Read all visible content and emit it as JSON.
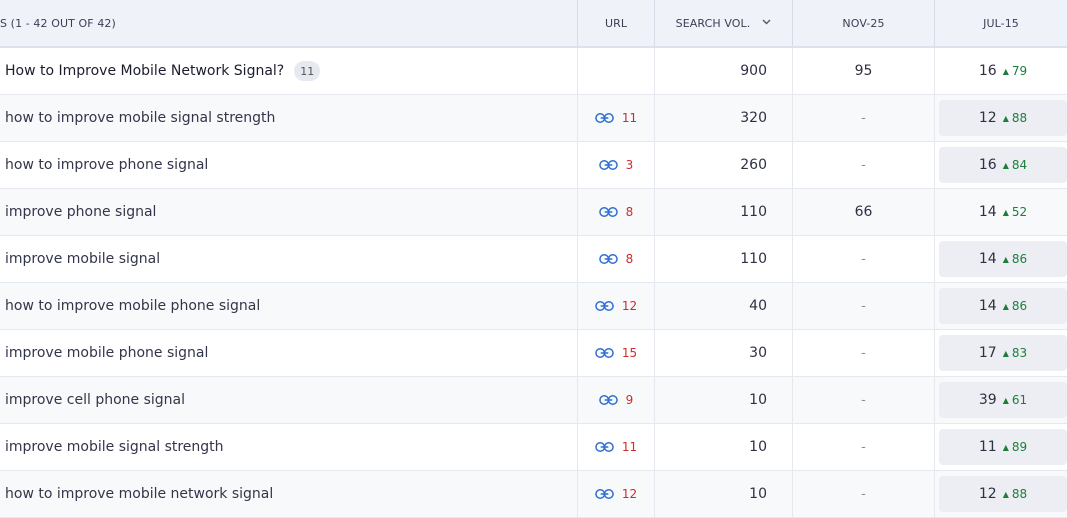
{
  "header": {
    "keywords": "S (1 - 42 OUT OF 42)",
    "url": "URL",
    "search_vol": "SEARCH VOL.",
    "nov": "NOV-25",
    "jul": "JUL-15",
    "sort_icon": "chevron-down-icon"
  },
  "group": {
    "title": "How to Improve Mobile Network Signal?",
    "count": "11",
    "search_vol": "900",
    "nov": "95",
    "jul_pos": "16",
    "jul_change": "79"
  },
  "rows": [
    {
      "keyword": "how to improve mobile signal strength",
      "url_count": "11",
      "search_vol": "320",
      "nov": "-",
      "jul_pos": "12",
      "jul_change": "88"
    },
    {
      "keyword": "how to improve phone signal",
      "url_count": "3",
      "search_vol": "260",
      "nov": "-",
      "jul_pos": "16",
      "jul_change": "84"
    },
    {
      "keyword": "improve phone signal",
      "url_count": "8",
      "search_vol": "110",
      "nov": "66",
      "jul_pos": "14",
      "jul_change": "52"
    },
    {
      "keyword": "improve mobile signal",
      "url_count": "8",
      "search_vol": "110",
      "nov": "-",
      "jul_pos": "14",
      "jul_change": "86"
    },
    {
      "keyword": "how to improve mobile phone signal",
      "url_count": "12",
      "search_vol": "40",
      "nov": "-",
      "jul_pos": "14",
      "jul_change": "86"
    },
    {
      "keyword": "improve mobile phone signal",
      "url_count": "15",
      "search_vol": "30",
      "nov": "-",
      "jul_pos": "17",
      "jul_change": "83"
    },
    {
      "keyword": "improve cell phone signal",
      "url_count": "9",
      "search_vol": "10",
      "nov": "-",
      "jul_pos": "39",
      "jul_change": "61"
    },
    {
      "keyword": "improve mobile signal strength",
      "url_count": "11",
      "search_vol": "10",
      "nov": "-",
      "jul_pos": "11",
      "jul_change": "89"
    },
    {
      "keyword": "how to improve mobile network signal",
      "url_count": "12",
      "search_vol": "10",
      "nov": "-",
      "jul_pos": "12",
      "jul_change": "88"
    }
  ],
  "colors": {
    "link_icon": "#2f6fd1",
    "url_count": "#d12b2b",
    "change_up": "#1d7e3c",
    "header_bg": "#f0f2fa"
  }
}
